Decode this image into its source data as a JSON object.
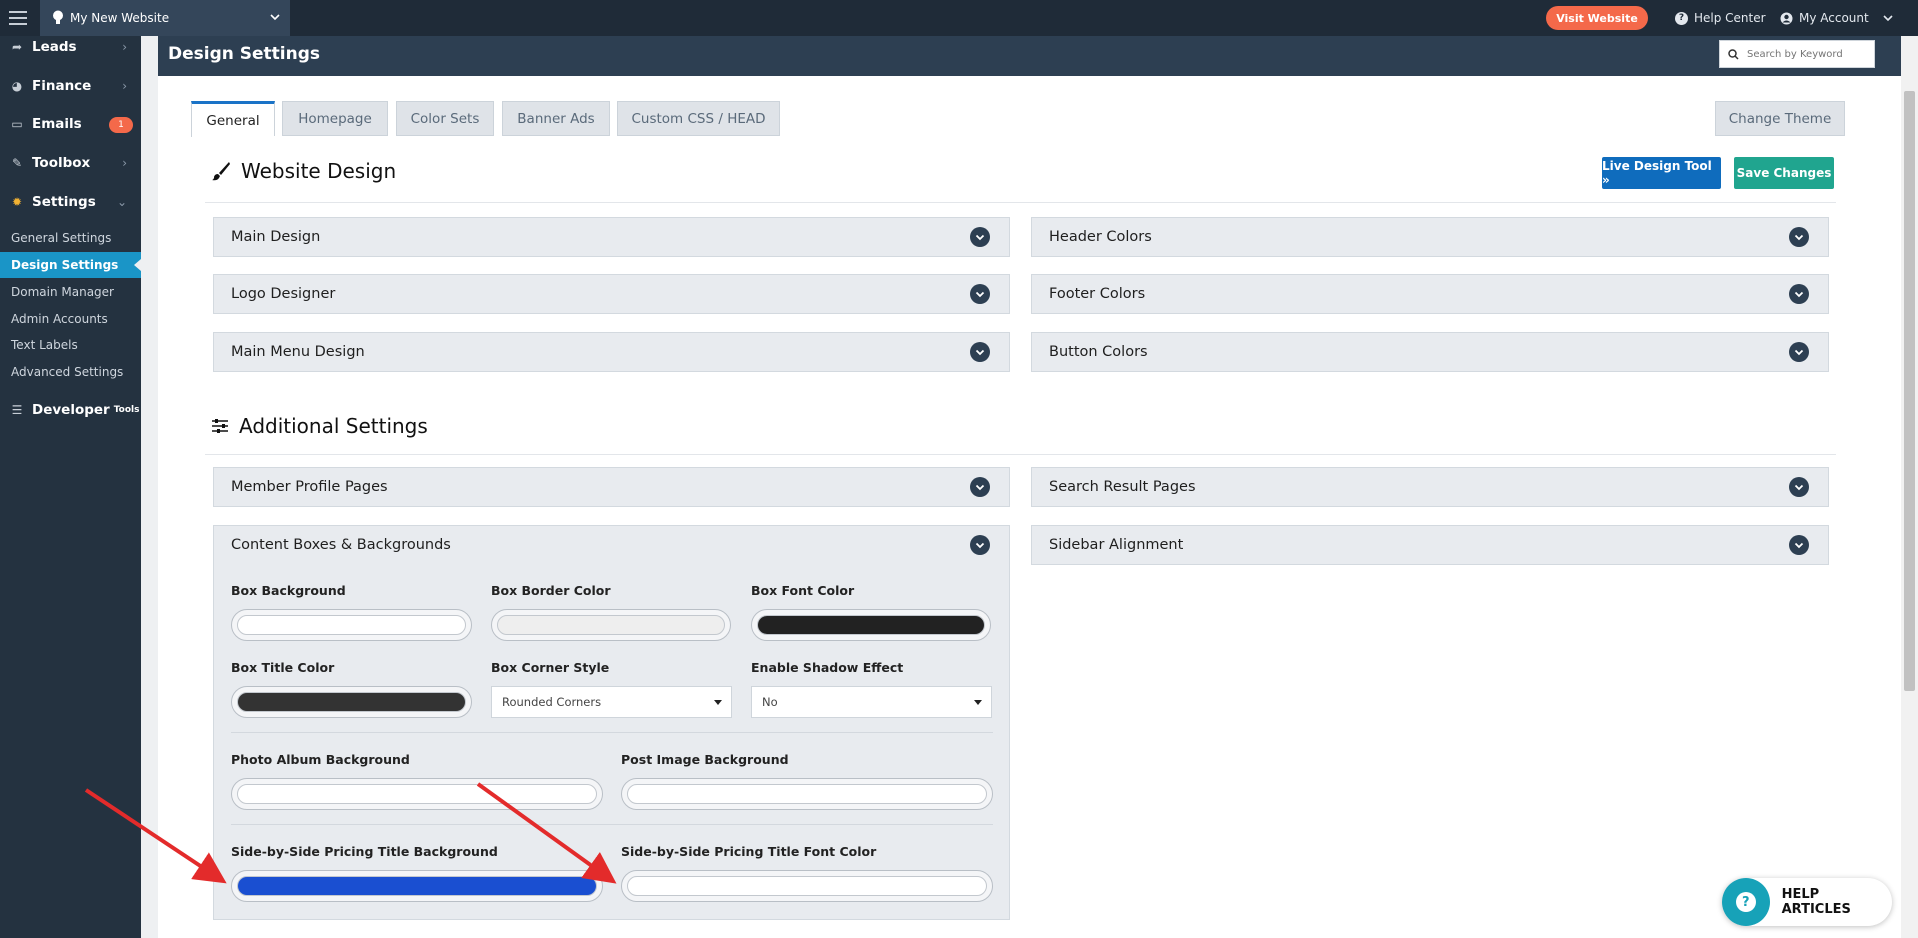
{
  "topbar": {
    "site_name": "My New Website",
    "visit_label": "Visit Website",
    "help_label": "Help Center",
    "account_label": "My Account"
  },
  "sidebar": {
    "items": [
      {
        "label": "Leads",
        "icon": "share-icon"
      },
      {
        "label": "Finance",
        "icon": "pie-chart-icon"
      },
      {
        "label": "Emails",
        "icon": "inbox-icon",
        "badge": "1"
      },
      {
        "label": "Toolbox",
        "icon": "wrench-icon"
      },
      {
        "label": "Settings",
        "icon": "gear-icon"
      }
    ],
    "sub_items": [
      "General Settings",
      "Design Settings",
      "Domain Manager",
      "Admin Accounts",
      "Text Labels",
      "Advanced Settings"
    ],
    "developer_label": "Developer",
    "developer_small": "Tools"
  },
  "header": {
    "title": "Design Settings",
    "search_placeholder": "Search by Keyword"
  },
  "tabs": [
    "General",
    "Homepage",
    "Color Sets",
    "Banner Ads",
    "Custom CSS / HEAD",
    "Change Theme"
  ],
  "website_design": {
    "title": "Website Design",
    "live_tool_label": "Live Design Tool »",
    "save_label": "Save Changes",
    "sections_left": [
      "Main Design",
      "Logo Designer",
      "Main Menu Design"
    ],
    "sections_right": [
      "Header Colors",
      "Footer Colors",
      "Button Colors"
    ]
  },
  "additional": {
    "title": "Additional Settings",
    "sections_left": [
      "Member Profile Pages",
      "Content Boxes & Backgrounds"
    ],
    "sections_right": [
      "Search Result Pages",
      "Sidebar Alignment"
    ]
  },
  "content_boxes": {
    "box_background": "Box Background",
    "box_border_color": "Box Border Color",
    "box_font_color": "Box Font Color",
    "box_title_color": "Box Title Color",
    "box_corner_style": "Box Corner Style",
    "box_corner_value": "Rounded Corners",
    "enable_shadow": "Enable Shadow Effect",
    "enable_shadow_value": "No",
    "photo_album_bg": "Photo Album Background",
    "post_image_bg": "Post Image Background",
    "pricing_title_bg": "Side-by-Side Pricing Title Background",
    "pricing_title_font": "Side-by-Side Pricing Title Font Color"
  },
  "colors": {
    "box_background": "#ffffff",
    "box_border": "#eeeeee",
    "box_font": "#222222",
    "box_title": "#333333",
    "photo_album": "#ffffff",
    "post_image": "#ffffff",
    "pricing_title_bg": "#1a4fd1",
    "pricing_title_font": "#ffffff",
    "accent_blue": "#0f6cbd",
    "save_green": "#20a58f",
    "visit_orange": "#f4694a",
    "annotation_arrow": "#e32b2b"
  },
  "help_articles_label": "HELP ARTICLES"
}
